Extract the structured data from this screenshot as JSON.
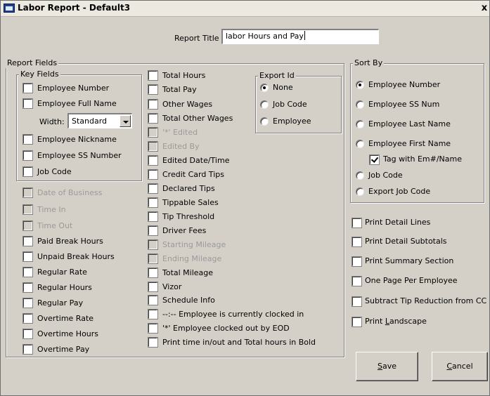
{
  "window": {
    "title": "Labor Report  - Default3",
    "close_label": "x"
  },
  "report_title": {
    "label": "Report Title",
    "value": "labor Hours and Pay"
  },
  "report_fields": {
    "group_label": "Report Fields",
    "key_fields": {
      "group_label": "Key Fields",
      "employee_number": "Employee Number",
      "employee_full_name": "Employee Full Name",
      "width_label": "Width:",
      "width_value": "Standard",
      "employee_nickname": "Employee Nickname",
      "employee_ss_number": "Employee SS Number",
      "job_code": "Job Code"
    },
    "col1": {
      "date_of_business": "Date of Business",
      "time_in": "Time In",
      "time_out": "Time Out",
      "paid_break_hours": "Paid Break Hours",
      "unpaid_break_hours": "Unpaid Break Hours",
      "regular_rate": "Regular Rate",
      "regular_hours": "Regular Hours",
      "regular_pay": "Regular Pay",
      "overtime_rate": "Overtime Rate",
      "overtime_hours": "Overtime Hours",
      "overtime_pay": "Overtime Pay"
    },
    "col2": {
      "total_hours": "Total Hours",
      "total_pay": "Total Pay",
      "other_wages": "Other Wages",
      "total_other_wages": "Total Other Wages",
      "edited_marker": "'*' Edited",
      "edited_by": "Edited By",
      "edited_date_time": "Edited Date/Time",
      "credit_card_tips": "Credit Card Tips",
      "declared_tips": "Declared Tips",
      "tippable_sales": "Tippable Sales",
      "tip_threshold": "Tip Threshold",
      "driver_fees": "Driver Fees",
      "starting_mileage": "Starting Mileage",
      "ending_mileage": "Ending Mileage",
      "total_mileage": "Total Mileage",
      "vizor": "Vizor",
      "schedule_info": "Schedule Info",
      "currently_clocked_in": "--:-- Employee is currently clocked in",
      "clocked_out_by_eod": "'*' Employee clocked out by EOD",
      "print_bold": "Print time in/out and Total hours in Bold"
    },
    "export_id": {
      "group_label": "Export Id",
      "none": "None",
      "job_code": "Job Code",
      "employee": "Employee"
    }
  },
  "sort_by": {
    "group_label": "Sort By",
    "employee_number": "Employee Number",
    "employee_ss_num": "Employee SS Num",
    "employee_last_name": "Employee Last Name",
    "employee_first_name": "Employee First Name",
    "tag_with": "Tag with Em#/Name",
    "job_code": "Job Code",
    "export_job_code": "Export Job Code"
  },
  "options": {
    "print_detail_lines": "Print Detail Lines",
    "print_detail_subtotals": "Print Detail Subtotals",
    "print_summary_section": "Print Summary Section",
    "one_page_per_employee": "One Page Per Employee",
    "subtract_tip_reduction": "Subtract Tip Reduction from CC",
    "print_landscape_pre": "Print ",
    "print_landscape_u": "L",
    "print_landscape_post": "andscape"
  },
  "buttons": {
    "save_u": "S",
    "save_rest": "ave",
    "cancel_u": "C",
    "cancel_rest": "ancel"
  }
}
